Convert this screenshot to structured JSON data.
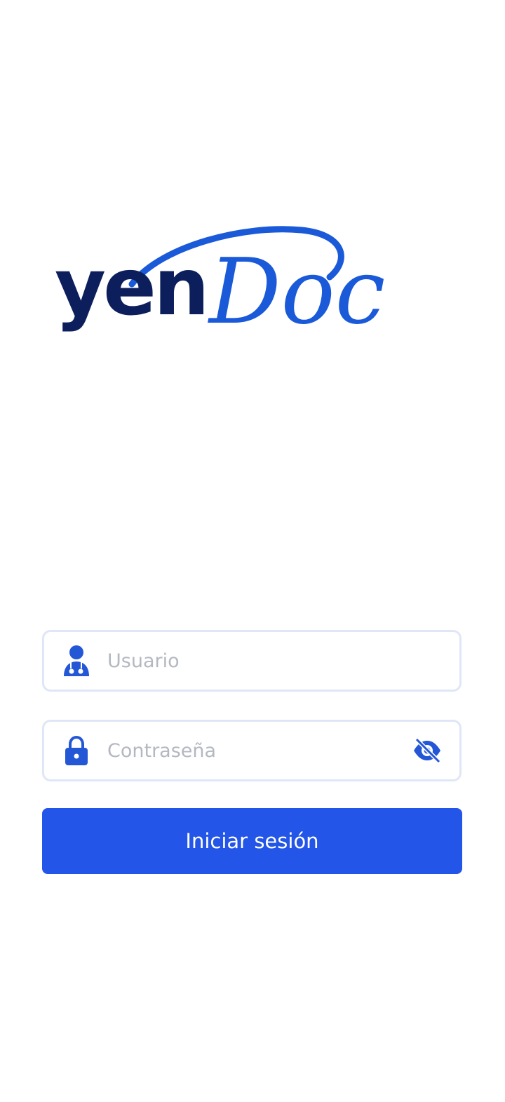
{
  "brand": {
    "part1": "yen",
    "part2": "Doc",
    "colors": {
      "dark": "#0c1f5c",
      "blue": "#1a5ad9"
    }
  },
  "login": {
    "username_placeholder": "Usuario",
    "password_placeholder": "Contraseña",
    "submit_label": "Iniciar sesión"
  },
  "icons": {
    "user": "doctor-user-icon",
    "lock": "lock-icon",
    "visibility": "eye-slash-icon"
  },
  "colors": {
    "accent": "#2255e8",
    "icon": "#2457d6",
    "field_border": "#dfe6f7",
    "placeholder": "#b4b8c0"
  }
}
